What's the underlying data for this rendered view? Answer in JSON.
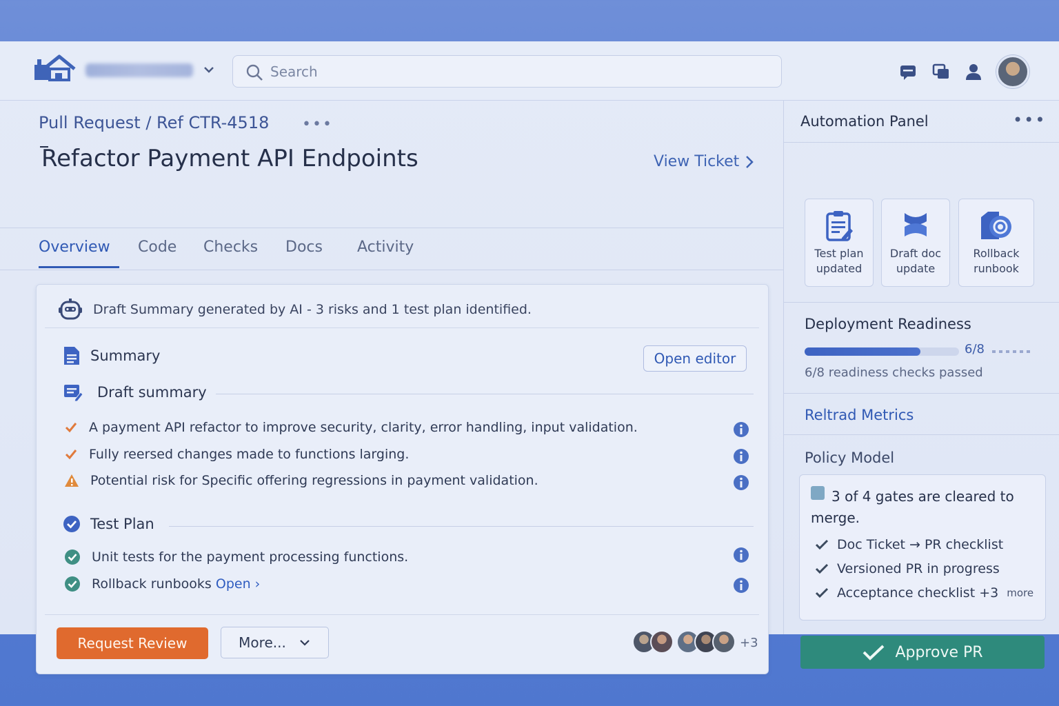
{
  "header": {
    "search_placeholder": "Search"
  },
  "pr": {
    "breadcrumb": "Pull Request / Ref CTR-4518",
    "title": "Refactor Payment API Endpoints",
    "view_ticket": "View Ticket"
  },
  "tabs": [
    {
      "label": "Overview",
      "active": true
    },
    {
      "label": "Code"
    },
    {
      "label": "Checks"
    },
    {
      "label": "Docs"
    },
    {
      "label": "Activity"
    }
  ],
  "card": {
    "ai_notice": "Draft Summary generated by AI - 3 risks and 1 test plan identified.",
    "summary_title": "Summary",
    "open_editor": "Open editor",
    "draft_title": "Draft summary",
    "draft_items": [
      {
        "icon": "check-orange",
        "text": "A payment API refactor to improve security, clarity, error handling, input validation."
      },
      {
        "icon": "check-orange",
        "text": "Fully reersed changes made to functions larging."
      },
      {
        "icon": "warning",
        "text": "Potential risk for Specific offering regressions in payment validation."
      }
    ],
    "test_plan_title": "Test Plan",
    "test_items": [
      {
        "text": "Unit tests for the payment processing functions."
      },
      {
        "text": "Rollback runbooks",
        "link": "Open ›"
      }
    ],
    "request_review": "Request Review",
    "more": "More...",
    "avatars_more": "+3"
  },
  "panel": {
    "title": "Automation Panel",
    "automations": [
      {
        "icon": "clipboard-icon",
        "line1": "Test plan",
        "line2": "updated"
      },
      {
        "icon": "doc-update-icon",
        "line1": "Draft doc",
        "line2": "update"
      },
      {
        "icon": "rollback-icon",
        "line1": "Rollback",
        "line2": "runbook"
      }
    ],
    "readiness_title": "Deployment Readiness",
    "readiness_value": "6/8",
    "readiness_fraction": 0.75,
    "readiness_sub": "6/8 readiness checks passed",
    "metrics_link": "Reltrad Metrics",
    "policy_title": "Policy Model",
    "policy_head": "3 of 4 gates are cleared to merge.",
    "policy_items": [
      {
        "text": "Doc Ticket → PR checklist"
      },
      {
        "text": "Versioned PR in progress"
      },
      {
        "text": "Acceptance checklist  +3",
        "extra": "more"
      }
    ],
    "approve": "Approve PR"
  },
  "colors": {
    "accent": "#3059b4",
    "review_button": "#e06a2e",
    "approve_button": "#2e8a7c",
    "check_orange": "#e07a3c",
    "check_teal": "#3f8f84"
  }
}
